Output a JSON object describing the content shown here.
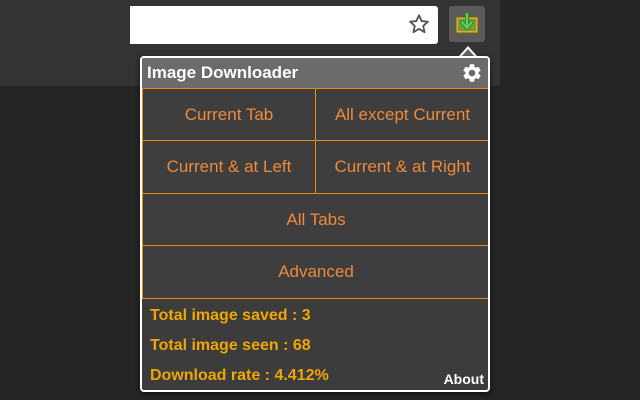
{
  "browser": {
    "star_icon": "star-icon",
    "extension_icon": "image-downloader-extension-icon"
  },
  "popup": {
    "title": "Image Downloader",
    "settings_icon": "gear-icon",
    "buttons": {
      "current_tab": "Current Tab",
      "all_except_current": "All except Current",
      "current_and_left": "Current & at Left",
      "current_and_right": "Current & at Right",
      "all_tabs": "All Tabs",
      "advanced": "Advanced"
    },
    "stats": {
      "saved": "Total image saved : 3",
      "seen": "Total image seen : 68",
      "rate": "Download rate : 4.412%"
    },
    "about": "About"
  },
  "colors": {
    "accent": "#e88a12",
    "button_text": "#ee8a3a",
    "stat_text": "#f0a500",
    "popup_bg": "#3c3c3c",
    "header_bg": "#6b6b6b"
  }
}
